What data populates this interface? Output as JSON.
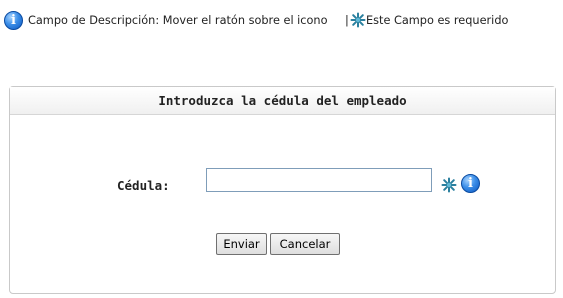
{
  "legend": {
    "info_icon": "info-icon",
    "description_text": "Campo de Descripción: Mover el ratón sobre el icono",
    "separator": "|",
    "required_icon": "asterisk-required-icon",
    "required_text": "Este Campo es requerido"
  },
  "panel": {
    "title": "Introduzca la cédula del empleado"
  },
  "form": {
    "cedula_label": "Cédula:",
    "cedula_value": "",
    "cedula_placeholder": ""
  },
  "buttons": {
    "submit_label": "Enviar",
    "cancel_label": "Cancelar"
  },
  "colors": {
    "info_blue": "#1e6fd8",
    "required_teal": "#2a7f9e",
    "input_border": "#7f9db9"
  }
}
